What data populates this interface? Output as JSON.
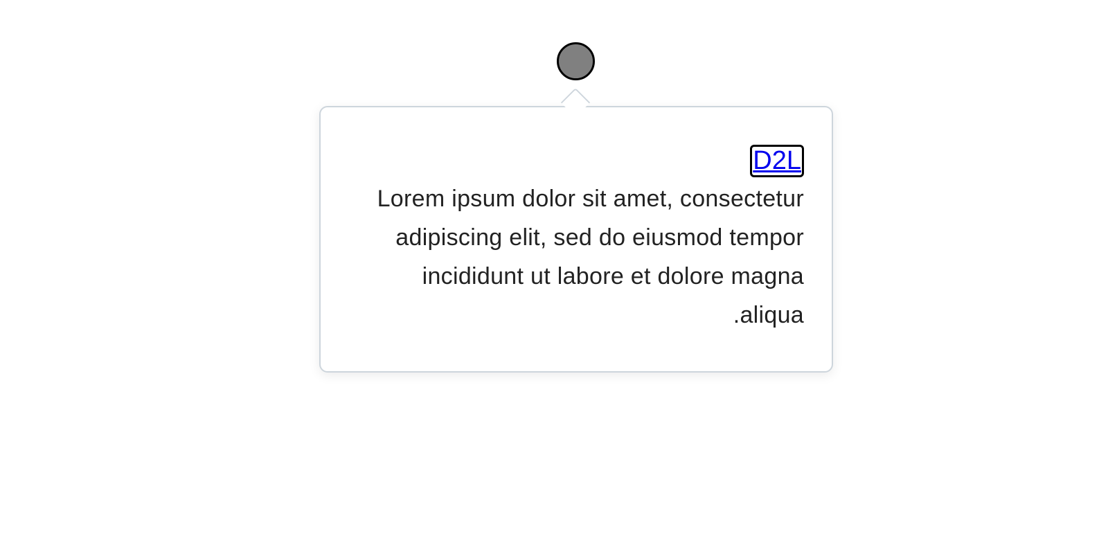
{
  "popover": {
    "link_text": "D2L",
    "body": "Lorem ipsum dolor sit amet, consectetur adipiscing elit, sed do eiusmod tempor incididunt ut labore et dolore magna aliqua."
  },
  "colors": {
    "anchor_fill": "#808080",
    "anchor_border": "#000000",
    "link": "#0000ee",
    "text": "#222222",
    "popover_border": "#cdd5dc"
  }
}
